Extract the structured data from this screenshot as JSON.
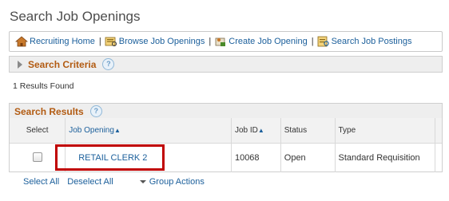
{
  "page": {
    "title": "Search Job Openings"
  },
  "toolbar": {
    "items": [
      {
        "label": "Recruiting Home",
        "icon": "home-icon"
      },
      {
        "label": "Browse Job Openings",
        "icon": "browse-icon"
      },
      {
        "label": "Create Job Opening",
        "icon": "create-icon"
      },
      {
        "label": "Search Job Postings",
        "icon": "search-postings-icon"
      }
    ],
    "separator": "|"
  },
  "criteria": {
    "label": "Search Criteria",
    "help": "?"
  },
  "results_found": "1 Results Found",
  "results": {
    "label": "Search Results",
    "help": "?",
    "columns": {
      "select": "Select",
      "job_opening": "Job Opening",
      "job_id": "Job ID",
      "status": "Status",
      "type": "Type"
    },
    "rows": [
      {
        "job_opening": "RETAIL CLERK 2",
        "job_id": "10068",
        "status": "Open",
        "type": "Standard Requisition"
      }
    ]
  },
  "footer": {
    "select_all": "Select All",
    "deselect_all": "Deselect All",
    "group_actions": "Group Actions"
  },
  "colors": {
    "link": "#1b5f9b",
    "section_label": "#b25b12",
    "highlight": "#c00000"
  }
}
